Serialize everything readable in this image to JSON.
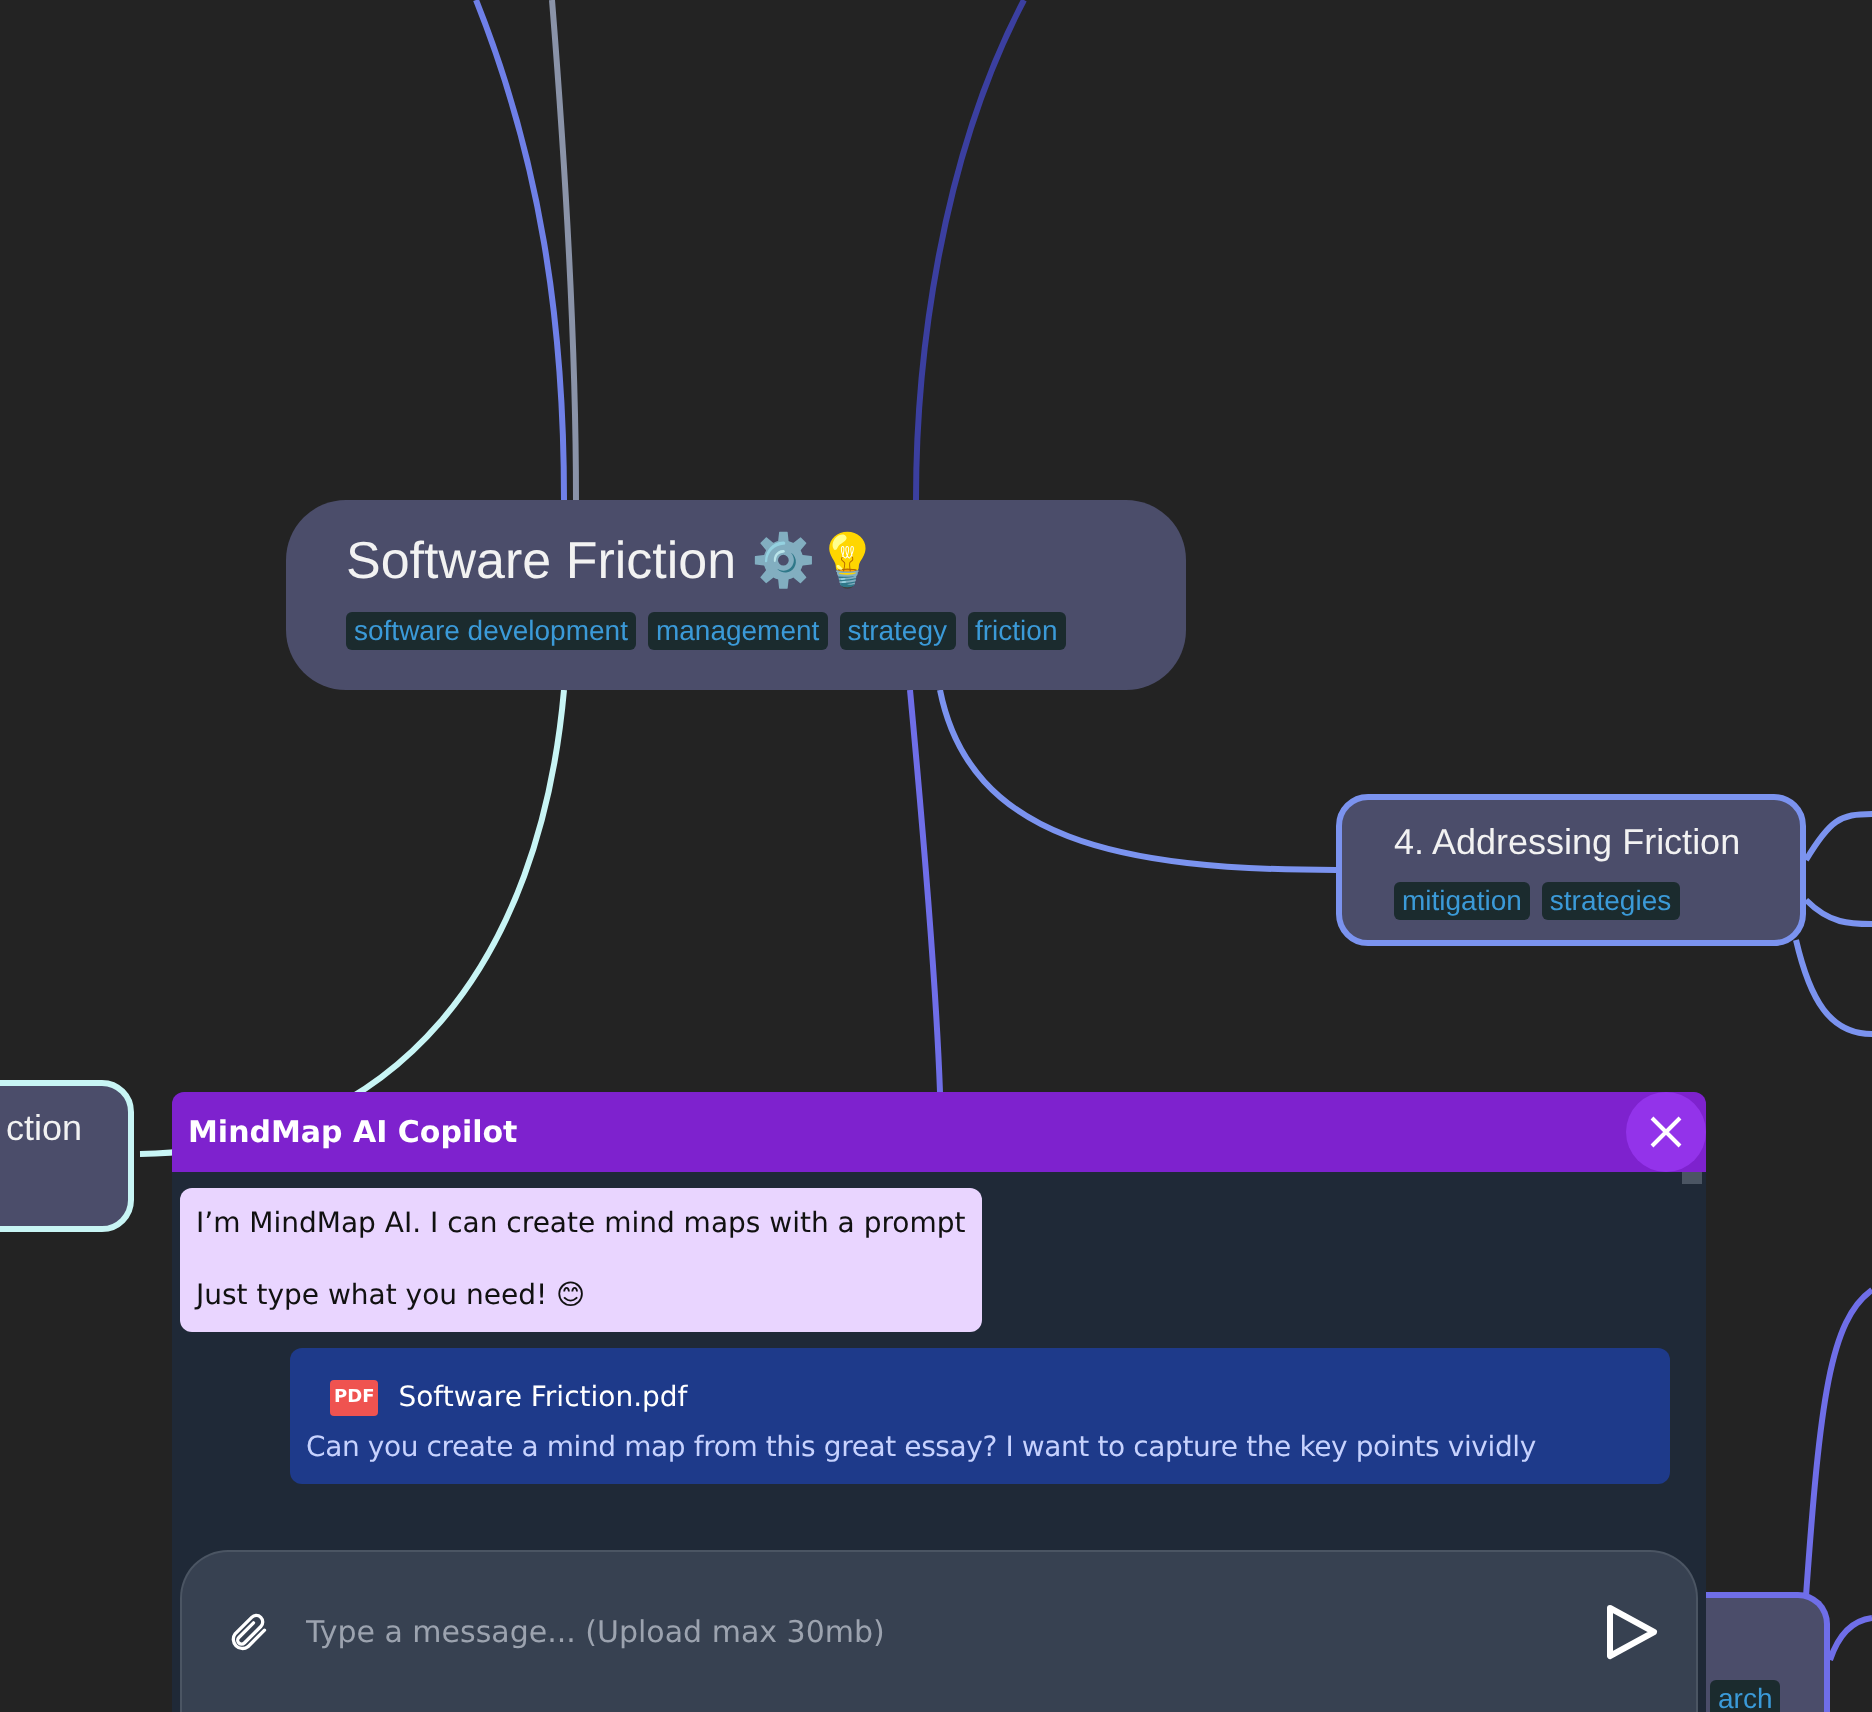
{
  "mindmap": {
    "nodes": [
      {
        "kind": "root",
        "title": "Software Friction ⚙️💡",
        "tags": [
          "software development",
          "management",
          "strategy",
          "friction"
        ]
      },
      {
        "kind": "branch",
        "title": "4. Addressing Friction",
        "tags": [
          "mitigation",
          "strategies"
        ],
        "color": "#7b93ef"
      },
      {
        "kind": "branch",
        "title": "ction",
        "color": "#c8f5f5"
      },
      {
        "kind": "branch",
        "tags": [
          "arch"
        ],
        "color": "#6f6ee8"
      }
    ]
  },
  "copilot": {
    "title": "MindMap AI Copilot",
    "messages": [
      {
        "kind": "assistant",
        "lines": [
          "I’m MindMap AI. I can create mind maps with a prompt",
          "Just type what you need! 😊"
        ]
      },
      {
        "kind": "user",
        "attachment": {
          "badge": "PDF",
          "name": "Software Friction.pdf"
        },
        "text": "Can you create a mind map from this great essay? I want to capture the key points vividly"
      }
    ],
    "input": {
      "placeholder": "Type a message... (Upload max 30mb)"
    }
  }
}
